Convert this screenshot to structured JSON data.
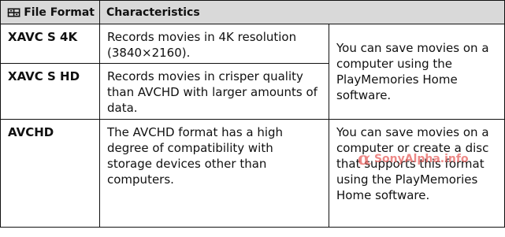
{
  "table": {
    "header": {
      "col1": "File Format",
      "col2": "Characteristics",
      "icon": "movie-format-icon"
    },
    "rows": [
      {
        "format": "XAVC S 4K",
        "description": "Records movies in 4K resolution (3840×2160)."
      },
      {
        "format": "XAVC S HD",
        "description": "Records movies in crisper quality than AVCHD with larger amounts of data."
      },
      {
        "format": "AVCHD",
        "description": "The AVCHD format has a high degree of compatibility with storage devices other than computers."
      }
    ],
    "save_note_xavc": "You can save movies on a computer using the PlayMemories Home software.",
    "save_note_avchd": "You can save movies on a computer or create a disc that supports this format using the PlayMemories Home software."
  },
  "watermark": {
    "text": "SonyAlpha.info",
    "logo": "α",
    "color": "#e8625f"
  }
}
